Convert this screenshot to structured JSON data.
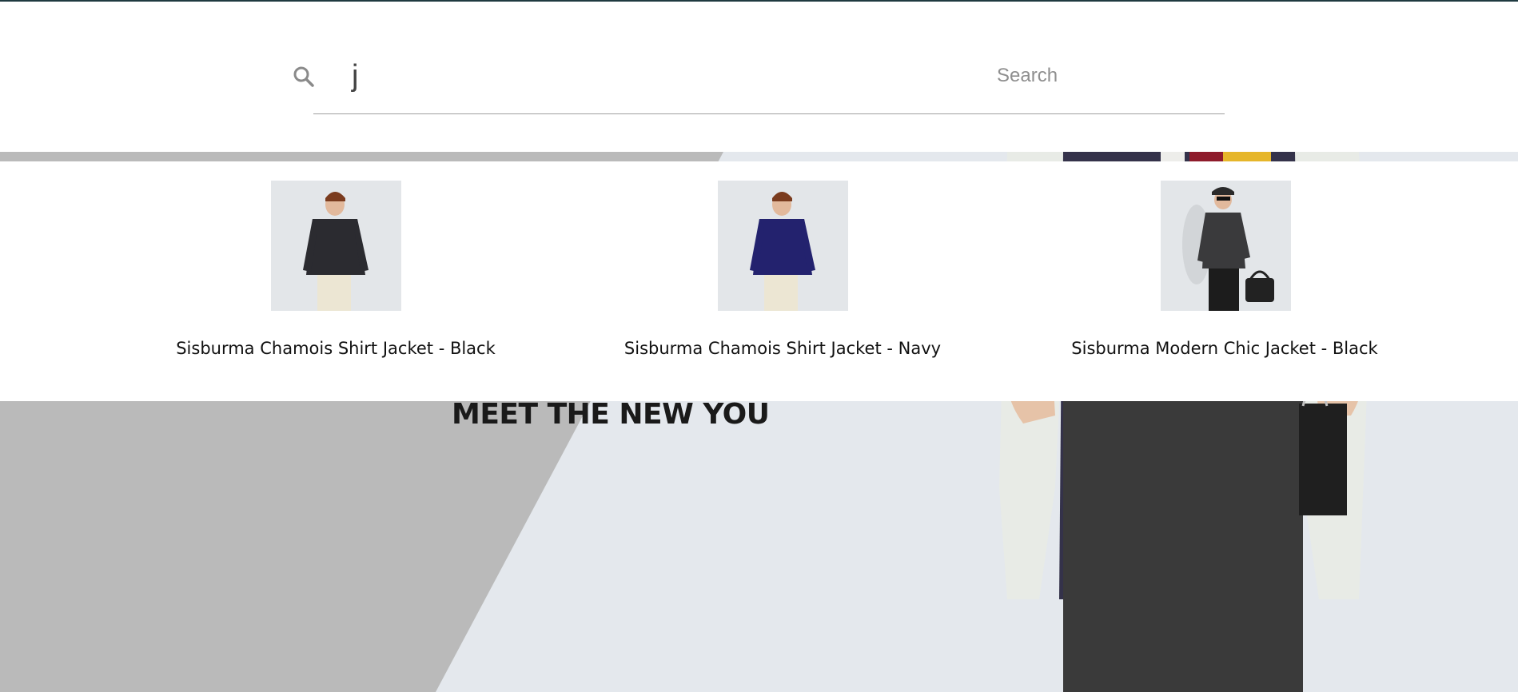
{
  "search": {
    "typed_text": "j",
    "placeholder": "Search"
  },
  "results": [
    {
      "name": "Sisburma Chamois Shirt Jacket - Black"
    },
    {
      "name": "Sisburma Chamois Shirt Jacket - Navy"
    },
    {
      "name": "Sisburma Modern Chic Jacket - Black"
    }
  ],
  "hero": {
    "tagline": "MEET THE NEW YOU"
  },
  "colors": {
    "top_line": "#1f3a40",
    "hero_background": "#e4e8ed",
    "hero_wedge": "#bababa",
    "search_underline": "#9e9e9e"
  }
}
